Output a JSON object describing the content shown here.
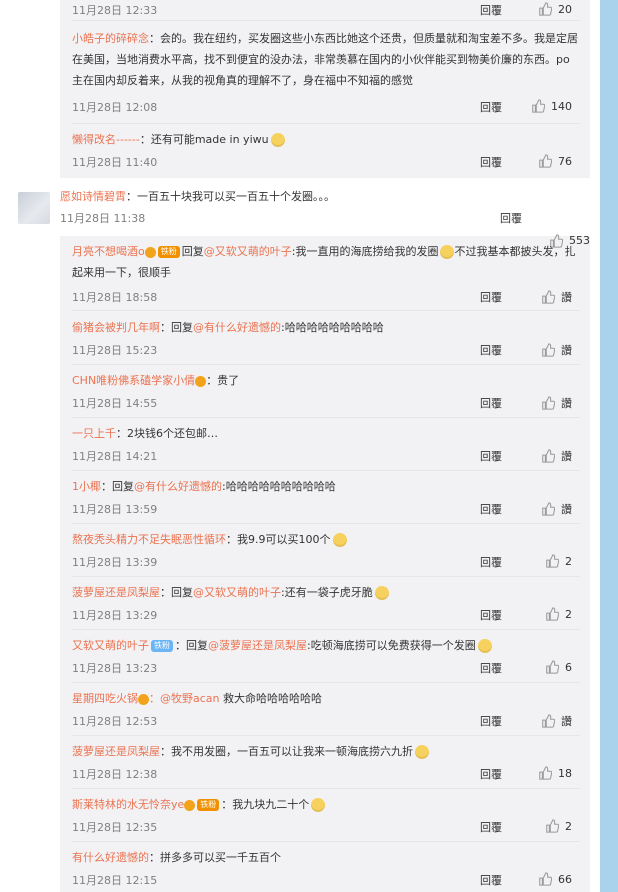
{
  "colors": {
    "accent": "#eb7350",
    "meta": "#808080",
    "sub_bg": "#f2f2f5",
    "strip": "#a9d3ec"
  },
  "labels": {
    "reply": "回覆"
  },
  "top_meta": {
    "time": "11月28日 12:33",
    "likes": "20"
  },
  "comments_a": [
    {
      "name": "小皓子的碎碎念",
      "text": "：会的。我在纽约，买发圈这些小东西比她这个还贵，但质量就和淘宝差不多。我是定居在美国，当地消费水平高，找不到便宜的没办法，非常羡慕在国内的小伙伴能买到物美价廉的东西。po主在国内却反着来，从我的视角真的理解不了，身在福中不知福的感觉",
      "time": "11月28日 12:08",
      "likes": "140"
    },
    {
      "name": "懒得改名------",
      "text": "：还有可能made in yiwu",
      "time": "11月28日 11:40",
      "likes": "76"
    }
  ],
  "main_comment": {
    "name": "愿如诗情碧霄",
    "text": "：一百五十块我可以买一百五十个发圈。。。",
    "time": "11月28日 11:38",
    "likes": "553"
  },
  "comments_b": [
    {
      "name": "月亮不想喝酒o",
      "badge": "铁粉",
      "reply_label": "回复",
      "mention": "@又软又萌的叶子",
      "text": ":我一直用的海底捞给我的发圈",
      "text2": "不过我基本都披头发，扎起来用一下，很顺手",
      "time": "11月28日 18:58",
      "likes": "讚"
    },
    {
      "name": "偷猪会被判几年啊",
      "reply_label": "：回复",
      "mention": "@有什么好遗憾的",
      "text": ":哈哈哈哈哈哈哈哈哈",
      "time": "11月28日 15:23",
      "likes": "讚"
    },
    {
      "name": "CHN唯粉佛系磕学家小倩",
      "text": "：贵了",
      "time": "11月28日 14:55",
      "likes": "讚"
    },
    {
      "name": "一只上千",
      "text": "：2块钱6个还包邮…",
      "time": "11月28日 14:21",
      "likes": "讚"
    },
    {
      "name": "1小椰",
      "reply_label": "：回复",
      "mention": "@有什么好遗憾的",
      "text": ":哈哈哈哈哈哈哈哈哈哈",
      "time": "11月28日 13:59",
      "likes": "讚"
    },
    {
      "name": "熬夜秃头精力不足失眠恶性循环",
      "text": "：我9.9可以买100个",
      "time": "11月28日 13:39",
      "likes": "2"
    },
    {
      "name": "菠萝屋还是凤梨屋",
      "reply_label": "：回复",
      "mention": "@又软又萌的叶子",
      "text": ":还有一袋子虎牙脆",
      "time": "11月28日 13:29",
      "likes": "2"
    },
    {
      "name": "又软又萌的叶子",
      "badge": "铁粉",
      "reply_label": "：回复",
      "mention": "@菠萝屋还是凤梨屋",
      "text": ":吃顿海底捞可以免费获得一个发圈",
      "time": "11月28日 13:23",
      "likes": "6"
    },
    {
      "name": "星期四吃火锅",
      "mention": "：@牧野acan",
      "text": " 救大命哈哈哈哈哈哈",
      "time": "11月28日 12:53",
      "likes": "讚"
    },
    {
      "name": "菠萝屋还是凤梨屋",
      "text": "：我不用发圈，一百五可以让我来一顿海底捞六九折",
      "time": "11月28日 12:38",
      "likes": "18"
    },
    {
      "name": "斯莱特林的水无怜奈ye",
      "badge": "铁粉",
      "text": "：我九块九二十个",
      "time": "11月28日 12:35",
      "likes": "2"
    },
    {
      "name": "有什么好遗憾的",
      "text": "：拼多多可以买一千五百个",
      "time": "11月28日 12:15",
      "likes": "66"
    }
  ]
}
